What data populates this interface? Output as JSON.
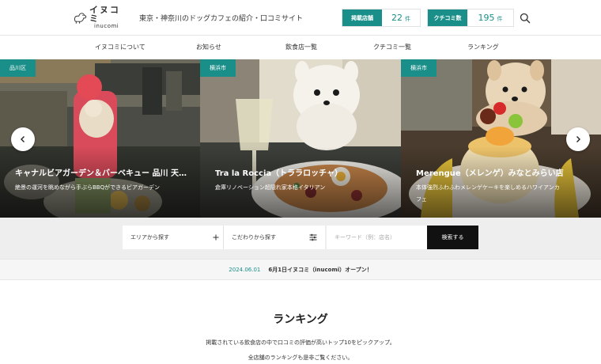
{
  "header": {
    "logo_jp": "イヌコミ",
    "logo_en": "inucomi",
    "tagline": "東京・神奈川のドッグカフェの紹介・口コミサイト",
    "stats": [
      {
        "label": "掲載店舗",
        "value": "22",
        "unit": "件"
      },
      {
        "label": "クチコミ数",
        "value": "195",
        "unit": "件"
      }
    ]
  },
  "nav": {
    "items": [
      {
        "label": "イヌコミについて"
      },
      {
        "label": "お知らせ"
      },
      {
        "label": "飲食店一覧"
      },
      {
        "label": "クチコミ一覧"
      },
      {
        "label": "ランキング"
      }
    ]
  },
  "slides": [
    {
      "area": "品川区",
      "title": "キャナルビアガーデン＆バーベキュー 品川 天…",
      "desc": "絶景の運河を眺めながら手ぶらBBQができるビアガーデン"
    },
    {
      "area": "横浜市",
      "title": "Tra la Roccia（トララロッチャ）",
      "desc": "倉庫リノベーション超隠れ家本格イタリアン"
    },
    {
      "area": "横浜市",
      "title": "Merengue（メレンゲ）みなとみらい店",
      "desc_line1": "本体強烈ふわふわメレンゲケーキを楽しめるハワイアンカ",
      "desc_line2": "フェ"
    }
  ],
  "search": {
    "area_label": "エリアから探す",
    "filter_label": "こだわりから探す",
    "keyword_placeholder": "キーワード（例：店名）",
    "submit_label": "検索する"
  },
  "news": {
    "date": "2024.06.01",
    "title": "6月1日イヌコミ（inucomi）オープン！"
  },
  "ranking": {
    "title": "ランキング",
    "desc_line1": "掲載されている飲食店の中で口コミの評価が高いトップ10をピックアップ。",
    "desc_line2": "全店舗のランキングも是非ご覧ください。"
  },
  "colors": {
    "accent": "#1a8f89"
  }
}
